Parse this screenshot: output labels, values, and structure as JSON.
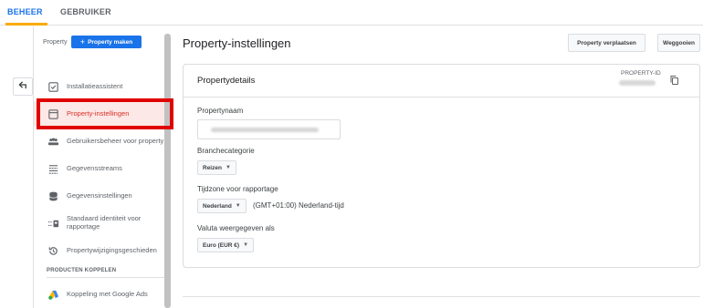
{
  "tabs": {
    "admin": "BEHEER",
    "user": "GEBRUIKER"
  },
  "sidebar": {
    "property_label": "Property",
    "create_property": "Property maken",
    "items": [
      {
        "label": "Installatieassistent",
        "icon": "checklist-icon"
      },
      {
        "label": "Property-instellingen",
        "icon": "window-icon"
      },
      {
        "label": "Gebruikersbeheer voor property",
        "icon": "people-icon"
      },
      {
        "label": "Gegevensstreams",
        "icon": "streams-icon"
      },
      {
        "label": "Gegevensinstellingen",
        "icon": "database-icon"
      },
      {
        "label": "Standaard identiteit voor rapportage",
        "icon": "identity-icon"
      },
      {
        "label": "Propertywijzigingsgeschieden",
        "icon": "history-icon"
      }
    ],
    "section_title": "PRODUCTEN KOPPELEN",
    "link_item": "Koppeling met Google Ads"
  },
  "main": {
    "title": "Property-instellingen",
    "move_button": "Property verplaatsen",
    "delete_button": "Weggooien",
    "card_title": "Propertydetails",
    "property_id_label": "PROPERTY-ID",
    "property_name_label": "Propertynaam",
    "industry_label": "Branchecategorie",
    "industry_value": "Reizen",
    "timezone_label": "Tijdzone voor rapportage",
    "timezone_country": "Nederland",
    "timezone_value": "(GMT+01:00) Nederland-tijd",
    "currency_label": "Valuta weergegeven als",
    "currency_value": "Euro (EUR €)"
  },
  "colors": {
    "accent": "#1a73e8",
    "active_nav": "#d93025",
    "highlight": "#e00000",
    "tab_underline": "#f9ab00"
  }
}
